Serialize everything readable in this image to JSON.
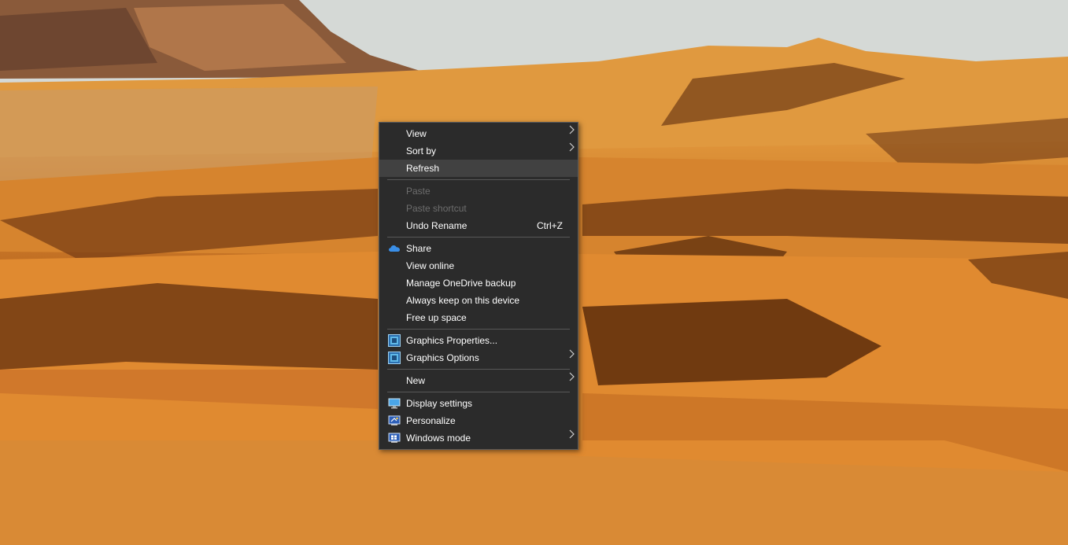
{
  "context_menu": {
    "view": "View",
    "sort_by": "Sort by",
    "refresh": "Refresh",
    "paste": "Paste",
    "paste_shortcut": "Paste shortcut",
    "undo_rename": "Undo Rename",
    "undo_rename_shortcut": "Ctrl+Z",
    "share": "Share",
    "view_online": "View online",
    "manage_onedrive_backup": "Manage OneDrive backup",
    "always_keep": "Always keep on this device",
    "free_up_space": "Free up space",
    "graphics_properties": "Graphics Properties...",
    "graphics_options": "Graphics Options",
    "new": "New",
    "display_settings": "Display settings",
    "personalize": "Personalize",
    "windows_mode": "Windows mode"
  },
  "colors": {
    "menu_bg": "#2b2b2b",
    "hover_bg": "#414141",
    "onedrive_blue": "#3a8fe8"
  }
}
